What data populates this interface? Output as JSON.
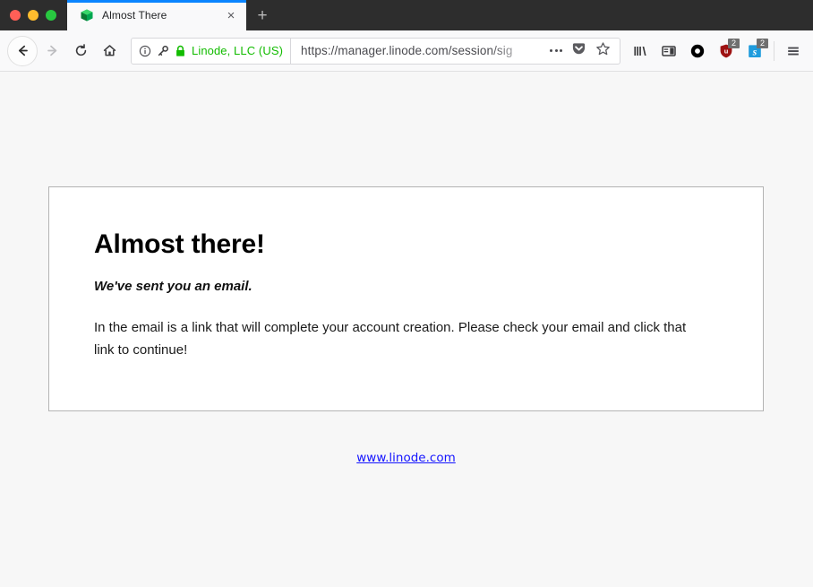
{
  "window": {
    "traffic_lights": [
      {
        "name": "close",
        "color": "#ff5f57"
      },
      {
        "name": "minimize",
        "color": "#febc2e"
      },
      {
        "name": "zoom",
        "color": "#28c840"
      }
    ],
    "titlebar_color": "#2d2d2d"
  },
  "tabs": [
    {
      "title": "Almost There",
      "favicon": "linode-cube-icon",
      "active": true,
      "accent_color": "#0a84ff",
      "close_label": "×"
    }
  ],
  "newtab": {
    "label": "+"
  },
  "nav": {
    "back": {
      "icon": "back-arrow-icon",
      "enabled": true
    },
    "forward": {
      "icon": "forward-arrow-icon",
      "enabled": false
    },
    "reload": {
      "icon": "reload-icon"
    },
    "home": {
      "icon": "home-icon"
    }
  },
  "urlbar": {
    "identity": {
      "info_icon": "info-circle-icon",
      "permission_icon": "key-icon",
      "lock_icon": "padlock-icon",
      "label": "Linode, LLC (US)",
      "color": "#12bc00"
    },
    "url": "https://manager.linode.com/session/sig",
    "page_actions_icon": "ellipsis-icon",
    "pocket_icon": "pocket-icon",
    "bookmark_icon": "star-icon"
  },
  "toolbar_right": [
    {
      "name": "library-icon",
      "badge": null
    },
    {
      "name": "sidebar-icon",
      "badge": null
    },
    {
      "name": "black-circle-extension-icon",
      "badge": null
    },
    {
      "name": "ublock-shield-extension-icon",
      "badge": "2"
    },
    {
      "name": "blue-s-extension-icon",
      "badge": "2"
    },
    {
      "name": "hamburger-menu-icon",
      "badge": null
    }
  ],
  "page": {
    "background_color": "#f7f7f7",
    "card": {
      "heading": "Almost there!",
      "subtitle": "We've sent you an email.",
      "body": "In the email is a link that will complete your account creation. Please check your email and click that link to continue!"
    },
    "footer_link": {
      "text": "www.linode.com",
      "color": "#1414ff"
    }
  }
}
